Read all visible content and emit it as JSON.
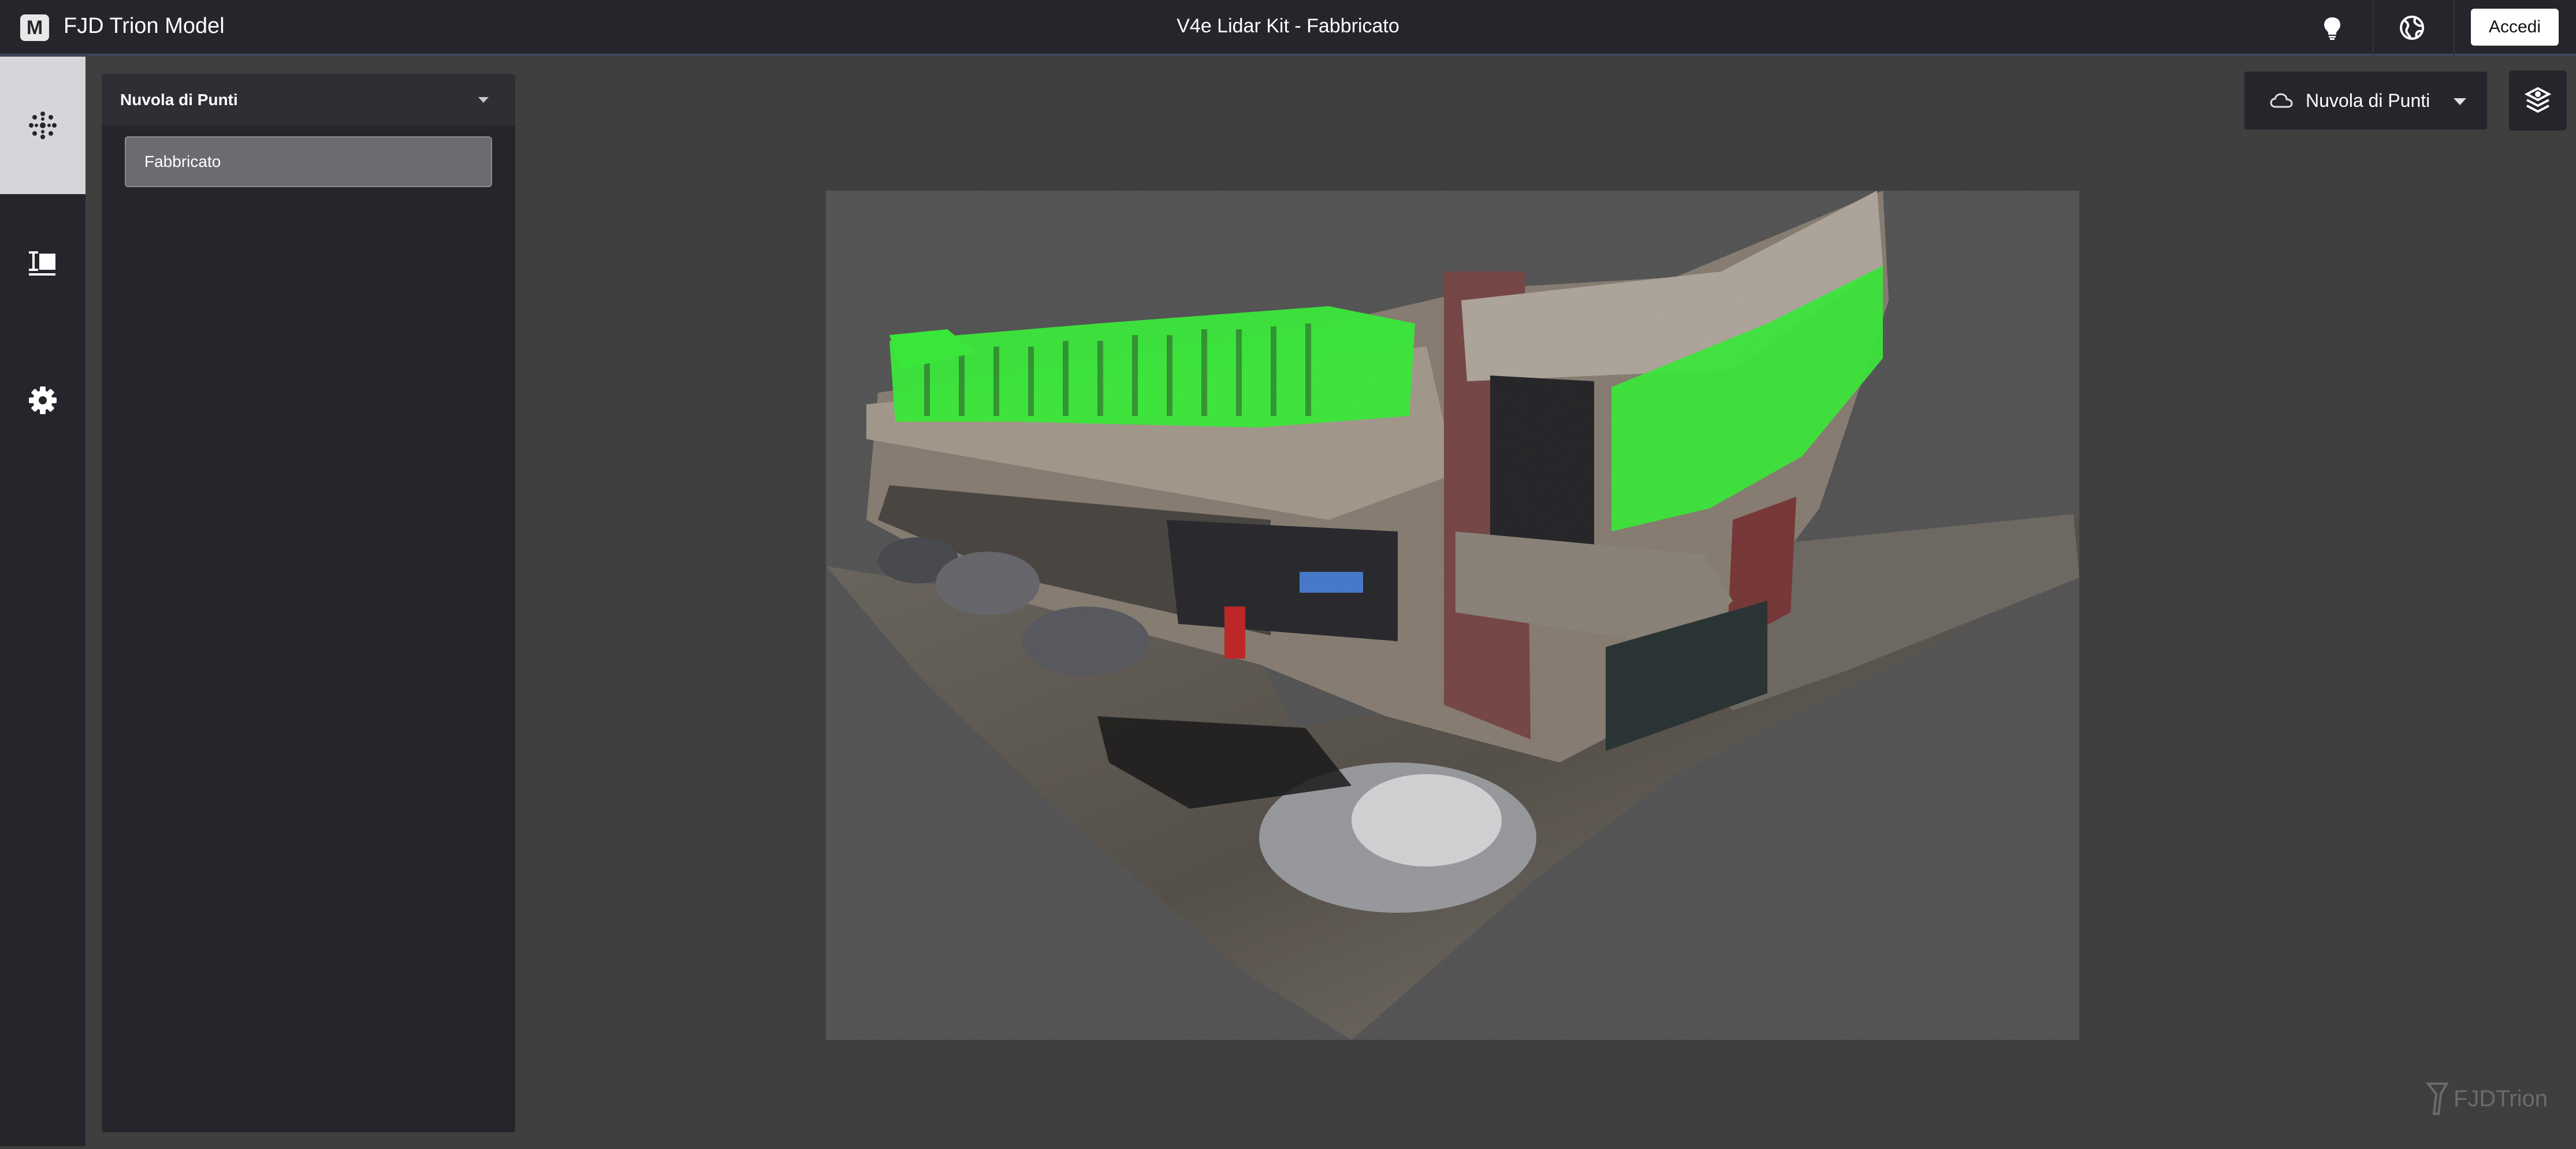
{
  "header": {
    "logo_letter": "M",
    "app_title": "FJD Trion Model",
    "document_title": "V4e Lidar Kit - Fabbricato",
    "login_label": "Accedi",
    "icons": [
      "lightbulb-icon",
      "globe-icon"
    ]
  },
  "sidebar": {
    "items": [
      {
        "icon": "point-cloud-icon",
        "active": true
      },
      {
        "icon": "measure-icon",
        "active": false
      },
      {
        "icon": "gear-icon",
        "active": false
      }
    ]
  },
  "panel": {
    "header_label": "Nuvola di Punti",
    "items": [
      {
        "label": "Fabbricato",
        "selected": true
      }
    ]
  },
  "viewport": {
    "mode_select": {
      "value": "Nuvola di Punti",
      "icon": "cloud-icon"
    },
    "layers_icon": "layers-icon",
    "watermark": "FJDTrion",
    "highlight_color": "#3cf03c"
  },
  "colors": {
    "topbar_bg": "#25262b",
    "viewport_bg": "#3f3f3f",
    "rail_active_bg": "#d5d6d9",
    "panel_item_bg": "#6b6c72"
  }
}
